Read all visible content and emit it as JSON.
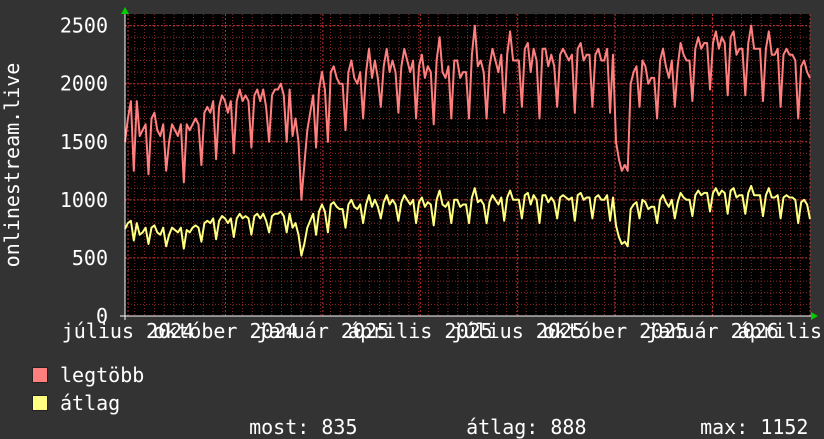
{
  "chart_data": {
    "type": "line",
    "ylabel": "onlinestream.live",
    "ylim": [
      0,
      2600
    ],
    "yticks": [
      0,
      500,
      1000,
      1500,
      2000,
      2500
    ],
    "xtick_labels": [
      "július 2024",
      "október 2024",
      "január 2025",
      "április 2025",
      "július 2025",
      "október 2025",
      "január 2026",
      "április 2026"
    ],
    "grid": true,
    "background": "#000000",
    "grid_color": "#8b2a2a",
    "series": [
      {
        "name": "legtöbb",
        "color": "#ff7f7f",
        "values": [
          1500,
          1700,
          1850,
          1250,
          1850,
          1550,
          1600,
          1650,
          1220,
          1700,
          1750,
          1600,
          1550,
          1650,
          1250,
          1500,
          1650,
          1600,
          1550,
          1650,
          1150,
          1650,
          1600,
          1650,
          1700,
          1650,
          1300,
          1750,
          1800,
          1750,
          1850,
          1350,
          1800,
          1900,
          1850,
          1750,
          1850,
          1400,
          1850,
          1950,
          1850,
          1900,
          1850,
          1450,
          1900,
          1950,
          1850,
          1950,
          1800,
          1500,
          1900,
          1950,
          1950,
          2000,
          1900,
          1500,
          1950,
          1550,
          1700,
          1500,
          1000,
          1300,
          1600,
          1750,
          1900,
          1450,
          1950,
          2100,
          1950,
          1500,
          2100,
          2150,
          2050,
          2000,
          2000,
          1600,
          2100,
          2200,
          2050,
          2000,
          2100,
          1700,
          2100,
          2300,
          2050,
          2200,
          2050,
          1800,
          2150,
          2300,
          2100,
          2200,
          2100,
          1750,
          2150,
          2300,
          2200,
          2100,
          2200,
          1700,
          2150,
          2250,
          2050,
          2150,
          2100,
          1650,
          2200,
          2400,
          2100,
          2050,
          2150,
          1700,
          2200,
          2200,
          2050,
          2100,
          2100,
          1700,
          2250,
          2500,
          2150,
          2200,
          2100,
          1700,
          2150,
          2300,
          2200,
          2100,
          2250,
          1750,
          2250,
          2450,
          2200,
          2200,
          2200,
          1800,
          2300,
          2350,
          2100,
          2300,
          2200,
          1700,
          2300,
          2300,
          2150,
          2250,
          2150,
          1800,
          2250,
          2300,
          2250,
          2200,
          2250,
          1750,
          2300,
          2350,
          2200,
          2250,
          2250,
          1800,
          2250,
          2300,
          2200,
          2200,
          2300,
          1750,
          2250,
          1500,
          1350,
          1250,
          1300,
          1250,
          2000,
          2100,
          2150,
          1800,
          2200,
          2150,
          2000,
          2050,
          2050,
          1700,
          2200,
          2300,
          2150,
          2050,
          2200,
          1800,
          2150,
          2350,
          2250,
          2200,
          2200,
          1850,
          2300,
          2400,
          2300,
          2350,
          2350,
          1950,
          2350,
          2450,
          2300,
          2400,
          2350,
          1900,
          2400,
          2450,
          2250,
          2300,
          2300,
          1900,
          2350,
          2500,
          2300,
          2300,
          2300,
          1850,
          2300,
          2450,
          2250,
          2250,
          2300,
          1800,
          2250,
          2300,
          2250,
          2250,
          2200,
          1700,
          2150,
          2200,
          2100,
          2050
        ]
      },
      {
        "name": "átlag",
        "color": "#ffff80",
        "values": [
          750,
          800,
          820,
          650,
          800,
          700,
          720,
          760,
          620,
          760,
          780,
          720,
          700,
          760,
          600,
          700,
          760,
          740,
          720,
          760,
          580,
          740,
          720,
          760,
          780,
          760,
          640,
          800,
          820,
          800,
          840,
          660,
          820,
          860,
          840,
          800,
          840,
          680,
          840,
          880,
          840,
          860,
          840,
          700,
          860,
          880,
          840,
          880,
          820,
          720,
          860,
          880,
          880,
          900,
          860,
          720,
          880,
          760,
          800,
          700,
          520,
          620,
          760,
          820,
          880,
          700,
          900,
          960,
          900,
          720,
          960,
          980,
          940,
          920,
          920,
          760,
          960,
          1000,
          940,
          920,
          960,
          800,
          960,
          1040,
          940,
          1000,
          940,
          840,
          980,
          1040,
          960,
          1000,
          960,
          820,
          980,
          1040,
          1000,
          960,
          1000,
          800,
          980,
          1020,
          940,
          980,
          960,
          780,
          1000,
          1080,
          960,
          940,
          980,
          800,
          1000,
          1000,
          940,
          960,
          960,
          800,
          1020,
          1100,
          980,
          1000,
          960,
          800,
          980,
          1040,
          1000,
          960,
          1020,
          820,
          1020,
          1080,
          1000,
          1000,
          1000,
          840,
          1040,
          1060,
          960,
          1040,
          1000,
          800,
          1040,
          1040,
          980,
          1020,
          980,
          840,
          1020,
          1040,
          1020,
          1000,
          1020,
          820,
          1040,
          1060,
          1000,
          1020,
          1020,
          840,
          1020,
          1040,
          1000,
          1000,
          1040,
          820,
          1020,
          780,
          680,
          620,
          640,
          600,
          920,
          960,
          980,
          840,
          1000,
          980,
          920,
          940,
          940,
          800,
          1000,
          1040,
          980,
          940,
          1000,
          840,
          980,
          1060,
          1020,
          1000,
          1000,
          860,
          1040,
          1080,
          1040,
          1060,
          1060,
          900,
          1060,
          1100,
          1040,
          1080,
          1060,
          880,
          1080,
          1100,
          1020,
          1040,
          1040,
          880,
          1060,
          1120,
          1040,
          1040,
          1040,
          860,
          1040,
          1100,
          1020,
          1020,
          1040,
          840,
          1020,
          1040,
          1020,
          1020,
          1000,
          800,
          980,
          1000,
          960,
          835
        ]
      }
    ],
    "stats": {
      "most_label": "most:",
      "most_value": "835",
      "avg_label": "átlag:",
      "avg_value": "888",
      "max_label": "max:",
      "max_value": "1152"
    }
  }
}
